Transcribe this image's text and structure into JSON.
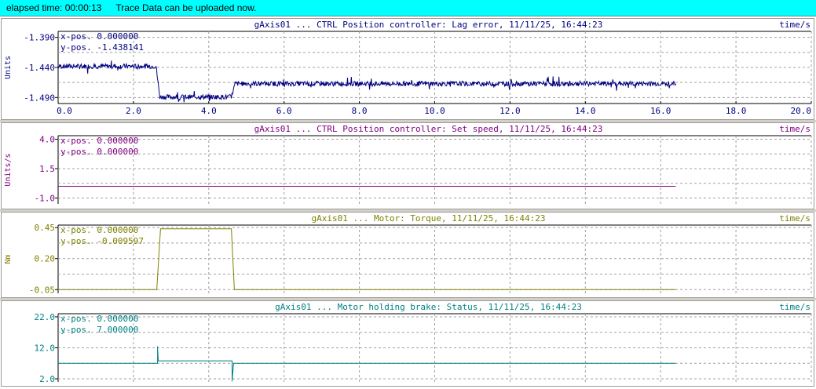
{
  "status": {
    "elapsed_label": "elapsed time: 00:00:13",
    "message": "Trace Data can be uploaded now."
  },
  "chart_data": [
    {
      "type": "line",
      "title": "gAxis01 ... CTRL Position controller: Lag error, 11/11/25, 16:44:23",
      "xlabel": "time/s",
      "ylabel": "Units",
      "color": "#000080",
      "xlim": [
        0,
        20
      ],
      "ylim": [
        -1.5,
        -1.38
      ],
      "yticks": [
        "-1.390",
        "-1.440",
        "-1.490"
      ],
      "ytick_values": [
        -1.39,
        -1.44,
        -1.49
      ],
      "xticks": [
        "0.0",
        "2.0",
        "4.0",
        "6.0",
        "8.0",
        "10.0",
        "12.0",
        "14.0",
        "16.0",
        "18.0",
        "20.0"
      ],
      "cursor": {
        "x_label": "x-pos.",
        "x_value": "0.000000",
        "y_label": "y-pos.",
        "y_value": "-1.438141"
      },
      "x": [
        0,
        2.6,
        2.7,
        4.6,
        4.7,
        16.4
      ],
      "y": [
        -1.438,
        -1.438,
        -1.489,
        -1.489,
        -1.467,
        -1.467
      ],
      "noise": 0.004
    },
    {
      "type": "line",
      "title": "gAxis01 ... CTRL Position controller: Set speed, 11/11/25, 16:44:23",
      "xlabel": "time/s",
      "ylabel": "Units/s",
      "color": "#800080",
      "xlim": [
        0,
        20
      ],
      "ylim": [
        -1.5,
        4.3
      ],
      "yticks": [
        "4.0",
        "1.5",
        "-1.0"
      ],
      "ytick_values": [
        4.0,
        1.5,
        -1.0
      ],
      "cursor": {
        "x_label": "x-pos.",
        "x_value": "0.000000",
        "y_label": "y-pos.",
        "y_value": "0.000000"
      },
      "x": [
        0,
        16.4
      ],
      "y": [
        0,
        0
      ],
      "noise": 0
    },
    {
      "type": "line",
      "title": "gAxis01 ... Motor: Torque, 11/11/25, 16:44:23",
      "xlabel": "time/s",
      "ylabel": "Nm",
      "color": "#808000",
      "xlim": [
        0,
        20
      ],
      "ylim": [
        -0.08,
        0.47
      ],
      "yticks": [
        "0.45",
        "0.20",
        "-0.05"
      ],
      "ytick_values": [
        0.45,
        0.2,
        -0.05
      ],
      "cursor": {
        "x_label": "x-pos.",
        "x_value": "0.000000",
        "y_label": "y-pos.",
        "y_value": "-0.009597"
      },
      "x": [
        0,
        2.62,
        2.72,
        4.6,
        4.68,
        16.4
      ],
      "y": [
        -0.05,
        -0.05,
        0.44,
        0.44,
        -0.05,
        -0.05
      ],
      "noise": 0
    },
    {
      "type": "line",
      "title": "gAxis01 ... Motor holding brake: Status, 11/11/25, 16:44:23",
      "xlabel": "time/s",
      "ylabel": "",
      "color": "#008080",
      "xlim": [
        0,
        20
      ],
      "ylim": [
        1.0,
        23.0
      ],
      "yticks": [
        "22.0",
        "12.0",
        "2.0"
      ],
      "ytick_values": [
        22.0,
        12.0,
        2.0
      ],
      "cursor": {
        "x_label": "x-pos.",
        "x_value": "0.000000",
        "y_label": "y-pos.",
        "y_value": "7.000000"
      },
      "x": [
        0,
        2.64,
        2.64,
        2.66,
        2.68,
        4.62,
        4.62,
        4.66,
        4.7,
        16.4
      ],
      "y": [
        7,
        7,
        12.5,
        7.8,
        7.8,
        7.8,
        1.2,
        7.0,
        7.0,
        7.0
      ],
      "noise": 0
    }
  ]
}
